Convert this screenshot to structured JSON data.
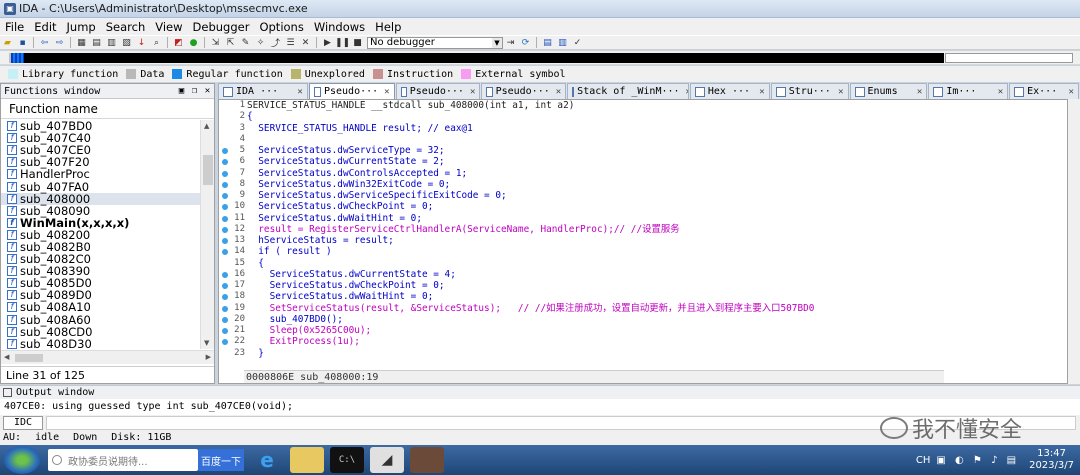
{
  "window": {
    "title": "IDA - C:\\Users\\Administrator\\Desktop\\mssecmvc.exe"
  },
  "menu": [
    "File",
    "Edit",
    "Jump",
    "Search",
    "View",
    "Debugger",
    "Options",
    "Windows",
    "Help"
  ],
  "toolbar": {
    "debugger_select": "No debugger"
  },
  "legend": [
    {
      "label": "Library function",
      "color": "#c6f0f8"
    },
    {
      "label": "Data",
      "color": "#b8b8b8"
    },
    {
      "label": "Regular function",
      "color": "#1e88e5"
    },
    {
      "label": "Unexplored",
      "color": "#b6b56b"
    },
    {
      "label": "Instruction",
      "color": "#c89090"
    },
    {
      "label": "External symbol",
      "color": "#f79cf1"
    }
  ],
  "functions_window": {
    "title": "Functions window",
    "column": "Function name",
    "items": [
      "sub_407BD0",
      "sub_407C40",
      "sub_407CE0",
      "sub_407F20",
      "HandlerProc",
      "sub_407FA0",
      "sub_408000",
      "sub_408090",
      "WinMain(x,x,x,x)",
      "sub_408200",
      "sub_4082B0",
      "sub_4082C0",
      "sub_408390",
      "sub_4085D0",
      "sub_4089D0",
      "sub_408A10",
      "sub_408A60",
      "sub_408CD0",
      "sub_408D30"
    ],
    "line_status": "Line 31 of 125"
  },
  "tabs": [
    {
      "label": "IDA ···"
    },
    {
      "label": "Pseudo···"
    },
    {
      "label": "Pseudo···"
    },
    {
      "label": "Pseudo···"
    },
    {
      "label": "Stack of _WinM···"
    },
    {
      "label": "Hex ···"
    },
    {
      "label": "Stru···"
    },
    {
      "label": "Enums"
    },
    {
      "label": "Im···"
    },
    {
      "label": "Ex···"
    }
  ],
  "code": {
    "line_numbers": [
      "1",
      "2",
      "3",
      "4",
      "5",
      "6",
      "7",
      "8",
      "9",
      "10",
      "11",
      "12",
      "13",
      "14",
      "15",
      "16",
      "17",
      "18",
      "19",
      "20",
      "21",
      "22",
      "23"
    ],
    "lines": [
      "SERVICE_STATUS_HANDLE __stdcall sub_408000(int a1, int a2)",
      "{",
      "  SERVICE_STATUS_HANDLE result; // eax@1",
      "",
      "  ServiceStatus.dwServiceType = 32;",
      "  ServiceStatus.dwCurrentState = 2;",
      "  ServiceStatus.dwControlsAccepted = 1;",
      "  ServiceStatus.dwWin32ExitCode = 0;",
      "  ServiceStatus.dwServiceSpecificExitCode = 0;",
      "  ServiceStatus.dwCheckPoint = 0;",
      "  ServiceStatus.dwWaitHint = 0;",
      "  result = RegisterServiceCtrlHandlerA(ServiceName, HandlerProc);// //设置服务",
      "  hServiceStatus = result;",
      "  if ( result )",
      "  {",
      "    ServiceStatus.dwCurrentState = 4;",
      "    ServiceStatus.dwCheckPoint = 0;",
      "    ServiceStatus.dwWaitHint = 0;",
      "    SetServiceStatus(result, &ServiceStatus);   // //如果注册成功，设置自动更新，并且进入到程序主要入口507BD0",
      "    sub_407BD0();",
      "    Sleep(0x5265C00u);",
      "    ExitProcess(1u);",
      "  }"
    ],
    "status": "0000806E sub_408000:19"
  },
  "output_window": {
    "title": "Output window",
    "text": "407CE0: using guessed type int sub_407CE0(void);"
  },
  "idc": {
    "label": "IDC"
  },
  "statusbar": {
    "au": "AU:",
    "state": "idle",
    "dir": "Down",
    "disk": "Disk: 11GB"
  },
  "watermark": {
    "text": "我不懂安全"
  },
  "taskbar": {
    "search_placeholder": "政协委员说期待...",
    "baidu": "百度一下",
    "tray_lang": "CH",
    "time": "13:47",
    "date": "2023/3/7"
  }
}
